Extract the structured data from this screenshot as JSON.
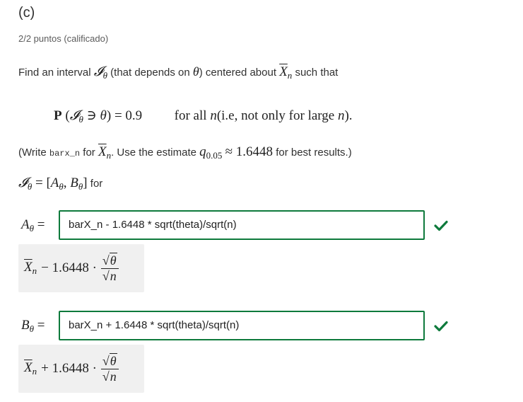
{
  "part_label": "(c)",
  "score": "2/2 puntos (calificado)",
  "question": {
    "prefix": "Find an interval",
    "mid1": "(that depends on",
    "mid2": ") centered about",
    "suffix": "such that"
  },
  "display_eq": {
    "left": "P",
    "equals": "= 0.9",
    "tail": "for all",
    "tail2": "(i.e, not only for large",
    "tail3": ")."
  },
  "hint": {
    "open": "(Write",
    "code": "barx_n",
    "for": "for",
    "after": ". Use the estimate",
    "approx": "≈ 1.6448",
    "end": "for best results.)"
  },
  "interval_line": {
    "for": "for"
  },
  "fields": {
    "a": {
      "value": "barX_n - 1.6448 * sqrt(theta)/sqrt(n)",
      "preview_op": "− 1.6448 ·"
    },
    "b": {
      "value": "barX_n + 1.6448 * sqrt(theta)/sqrt(n)",
      "preview_op": "+ 1.6448 ·"
    }
  },
  "colors": {
    "correct": "#0e7a3c",
    "preview_bg": "#f0f0f0"
  },
  "icons": {
    "correct": "checkmark-icon"
  }
}
